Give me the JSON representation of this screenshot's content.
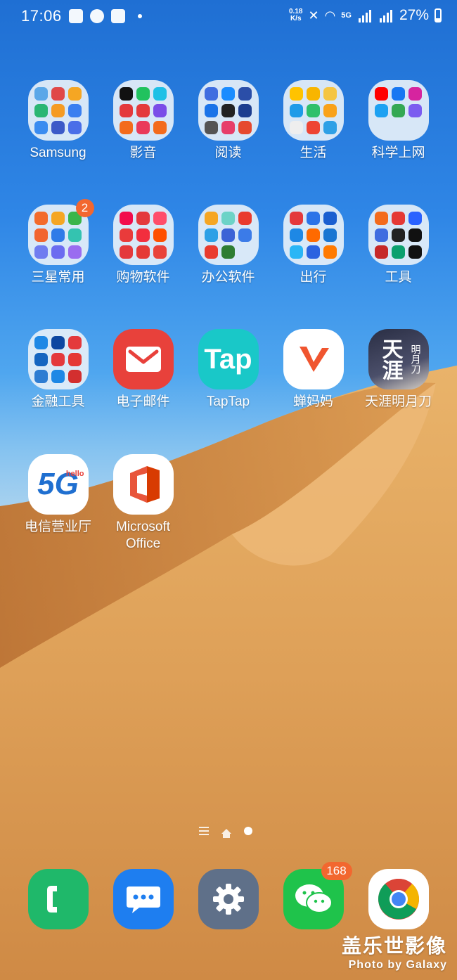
{
  "status_bar": {
    "time": "17:06",
    "net_speed_value": "0.18",
    "net_speed_unit": "K/s",
    "network_label": "5G",
    "battery": "27%"
  },
  "apps": [
    {
      "label": "Samsung",
      "type": "folder",
      "badge": ""
    },
    {
      "label": "影音",
      "type": "folder",
      "badge": ""
    },
    {
      "label": "阅读",
      "type": "folder",
      "badge": ""
    },
    {
      "label": "生活",
      "type": "folder",
      "badge": ""
    },
    {
      "label": "科学上网",
      "type": "folder",
      "badge": ""
    },
    {
      "label": "三星常用",
      "type": "folder",
      "badge": "2"
    },
    {
      "label": "购物软件",
      "type": "folder",
      "badge": ""
    },
    {
      "label": "办公软件",
      "type": "folder",
      "badge": ""
    },
    {
      "label": "出行",
      "type": "folder",
      "badge": ""
    },
    {
      "label": "工具",
      "type": "folder",
      "badge": ""
    },
    {
      "label": "金融工具",
      "type": "folder",
      "badge": ""
    },
    {
      "label": "电子邮件",
      "type": "app",
      "badge": ""
    },
    {
      "label": "TapTap",
      "type": "app",
      "badge": ""
    },
    {
      "label": "蝉妈妈",
      "type": "app",
      "badge": ""
    },
    {
      "label": "天涯明月刀",
      "type": "app",
      "badge": ""
    },
    {
      "label": "电信营业厅",
      "type": "app",
      "badge": ""
    },
    {
      "label": "Microsoft Office",
      "type": "app",
      "badge": ""
    }
  ],
  "icon_text": {
    "taptap": "Tap",
    "fiveg": "5G",
    "hello": "hello",
    "tianya": "天涯",
    "mingyue": "明月刀"
  },
  "dock": [
    {
      "name": "phone",
      "badge": ""
    },
    {
      "name": "messages",
      "badge": ""
    },
    {
      "name": "settings",
      "badge": ""
    },
    {
      "name": "wechat",
      "badge": "168"
    },
    {
      "name": "chrome",
      "badge": ""
    }
  ],
  "watermark": {
    "main": "盖乐世影像",
    "sub": "Photo by Galaxy"
  },
  "colors": {
    "badge": "#f2672f",
    "sand": "#e3a054",
    "sky_top": "#1f6fd3"
  }
}
